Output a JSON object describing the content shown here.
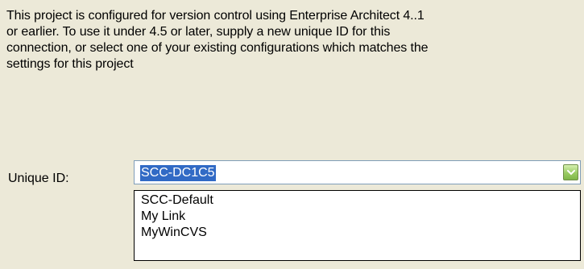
{
  "dialog": {
    "description": "This project is configured for version control using Enterprise Architect 4..1\nor earlier. To use it under 4.5 or later, supply a new unique ID for this\nconnection, or select one of your existing configurations which matches the\nsettings for this project",
    "unique_id_label": "Unique ID:",
    "unique_id": {
      "selected_value": "SCC-DC1C5",
      "options": [
        "SCC-Default",
        "My Link",
        "MyWinCVS"
      ]
    },
    "colors": {
      "background": "#ece9d8",
      "selection": "#316ac5",
      "dropdown_button": "#9acb63"
    },
    "icons": {
      "dropdown": "chevron-down-icon"
    }
  }
}
